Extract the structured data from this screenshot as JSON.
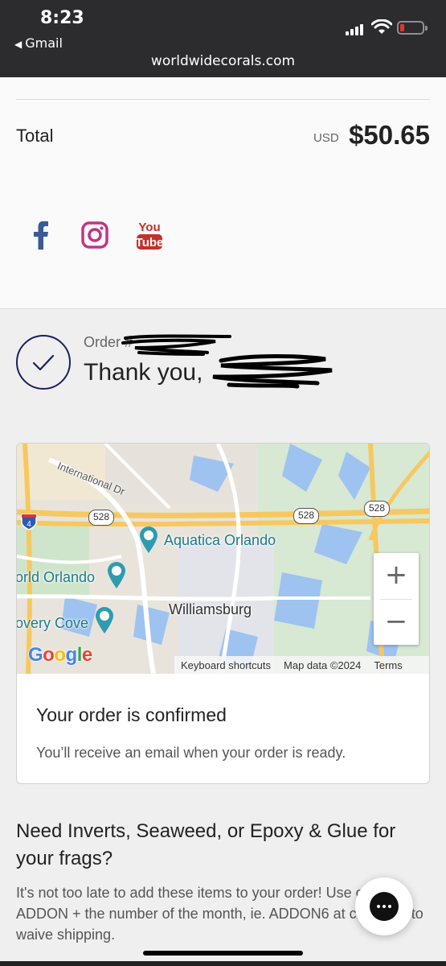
{
  "status_bar": {
    "time": "8:23",
    "back_app": "Gmail",
    "url": "worldwidecorals.com",
    "battery_color": "#e0362c"
  },
  "summary": {
    "total_label": "Total",
    "currency": "USD",
    "total_value": "$50.65"
  },
  "social": [
    {
      "name": "facebook-icon",
      "glyph": "f",
      "color": "#3b5998"
    },
    {
      "name": "instagram-icon",
      "color": "#c13584"
    },
    {
      "name": "youtube-icon",
      "top": "You",
      "bottom": "Tube",
      "color": "#c4302b"
    }
  ],
  "order": {
    "number_prefix": "Order #",
    "thank_you": "Thank you,"
  },
  "map": {
    "labels": {
      "international_dr": "International Dr",
      "aquatica": "Aquatica Orlando",
      "world_orlando": "orld Orlando",
      "williamsburg": "Williamsburg",
      "discovery_cove": "overy Cove"
    },
    "shields": [
      "528",
      "528",
      "528"
    ],
    "interstate": "4",
    "zoom_in": "+",
    "zoom_out": "−",
    "google": "Google",
    "footer": {
      "shortcuts": "Keyboard shortcuts",
      "map_data": "Map data ©2024",
      "terms": "Terms"
    }
  },
  "confirmation": {
    "title": "Your order is confirmed",
    "subtitle": "You’ll receive an email when your order is ready."
  },
  "upsell": {
    "title": "Need Inverts, Seaweed, or Epoxy & Glue for your frags?",
    "body": "It's not too late to add these items to your order! Use code: ADDON + the number of the month, ie. ADDON6 at checkout to waive shipping."
  },
  "colors": {
    "brand_navy": "#1a1f5e",
    "map_teal": "#1f7a8c"
  }
}
